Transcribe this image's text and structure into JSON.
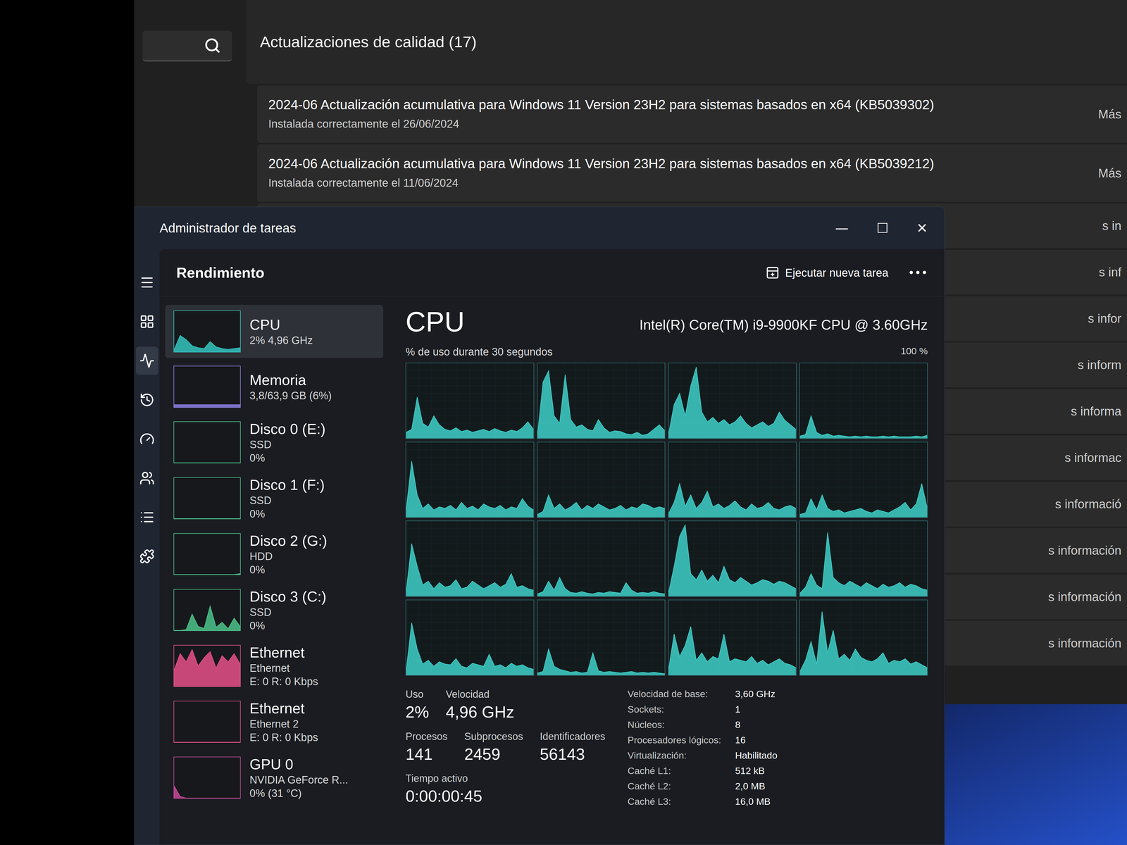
{
  "update_window": {
    "section_title": "Actualizaciones de calidad (17)",
    "updates": [
      {
        "title": "2024-06 Actualización acumulativa para Windows 11 Version 23H2 para sistemas basados en x64 (KB5039302)",
        "status": "Instalada correctamente el 26/06/2024",
        "link": "Más"
      },
      {
        "title": "2024-06 Actualización acumulativa para Windows 11 Version 23H2 para sistemas basados en x64 (KB5039212)",
        "status": "Instalada correctamente el 11/06/2024",
        "link": "Más"
      }
    ],
    "hidden_links": [
      "s in",
      "s inf",
      "s infor",
      "s inform",
      "s informa",
      "s informac",
      "s informació",
      "s información",
      "s información",
      "s información"
    ]
  },
  "task_manager": {
    "title": "Administrador de tareas",
    "controls": [
      "—",
      "☐",
      "✕"
    ],
    "nav": [
      {
        "kind": "menu",
        "selected": false
      },
      {
        "kind": "processes",
        "selected": false
      },
      {
        "kind": "performance",
        "selected": true
      },
      {
        "kind": "history",
        "selected": false
      },
      {
        "kind": "startup",
        "selected": false
      },
      {
        "kind": "users",
        "selected": false
      },
      {
        "kind": "details",
        "selected": false
      },
      {
        "kind": "services",
        "selected": false
      }
    ],
    "page_title": "Rendimiento",
    "run_task": "Ejecutar nueva tarea",
    "more": "•••",
    "resources": [
      {
        "name": "CPU",
        "lines": [
          "2% 4,96 GHz"
        ],
        "selected": true,
        "color": "#35c4bf",
        "values": [
          5,
          40,
          30,
          15,
          10,
          8,
          25,
          12,
          8,
          6,
          8,
          10
        ]
      },
      {
        "name": "Memoria",
        "lines": [
          "3,8/63,9 GB (6%)"
        ],
        "selected": false,
        "color": "#8b7fe0",
        "values": [
          6,
          6,
          6,
          6,
          6,
          6,
          6,
          6,
          6,
          6,
          6,
          6
        ]
      },
      {
        "name": "Disco 0 (E:)",
        "lines": [
          "SSD",
          "0%"
        ],
        "selected": false,
        "color": "#4cc38a",
        "values": [
          0,
          0,
          0,
          0,
          0,
          0,
          0,
          0,
          0,
          0,
          0,
          0
        ]
      },
      {
        "name": "Disco 1 (F:)",
        "lines": [
          "SSD",
          "0%"
        ],
        "selected": false,
        "color": "#4cc38a",
        "values": [
          0,
          0,
          0,
          0,
          0,
          0,
          0,
          0,
          0,
          0,
          0,
          0
        ]
      },
      {
        "name": "Disco 2 (G:)",
        "lines": [
          "HDD",
          "0%"
        ],
        "selected": false,
        "color": "#4cc38a",
        "values": [
          0,
          0,
          0,
          0,
          0,
          0,
          0,
          0,
          0,
          0,
          0,
          2
        ]
      },
      {
        "name": "Disco 3 (C:)",
        "lines": [
          "SSD",
          "0%"
        ],
        "selected": false,
        "color": "#4cc38a",
        "values": [
          0,
          0,
          2,
          40,
          10,
          5,
          60,
          8,
          20,
          4,
          30,
          10
        ]
      },
      {
        "name": "Ethernet",
        "lines": [
          "Ethernet",
          "E: 0 R: 0 Kbps"
        ],
        "selected": false,
        "color": "#e6508a",
        "values": [
          40,
          80,
          60,
          90,
          50,
          70,
          85,
          45,
          75,
          60,
          80,
          55
        ]
      },
      {
        "name": "Ethernet",
        "lines": [
          "Ethernet 2",
          "E: 0 R: 0 Kbps"
        ],
        "selected": false,
        "color": "#e6508a",
        "values": [
          0,
          0,
          0,
          0,
          0,
          0,
          0,
          0,
          0,
          0,
          0,
          0
        ]
      },
      {
        "name": "GPU 0",
        "lines": [
          "NVIDIA GeForce R...",
          "0% (31 °C)"
        ],
        "selected": false,
        "color": "#c84a9a",
        "values": [
          30,
          4,
          0,
          0,
          0,
          0,
          0,
          0,
          0,
          0,
          0,
          0
        ]
      }
    ],
    "cpu": {
      "title": "CPU",
      "model": "Intel(R) Core(TM) i9-9900KF CPU @ 3.60GHz",
      "chart_label": "% de uso durante 30 segundos",
      "max_label": "100 %",
      "cores": [
        [
          8,
          12,
          55,
          20,
          15,
          30,
          18,
          12,
          10,
          14,
          9,
          11,
          8,
          10,
          12,
          9,
          13,
          10,
          8,
          11,
          9,
          14,
          22,
          12
        ],
        [
          5,
          75,
          90,
          30,
          20,
          85,
          25,
          15,
          18,
          12,
          10,
          25,
          14,
          8,
          10,
          9,
          6,
          5,
          8,
          4,
          6,
          12,
          18,
          10
        ],
        [
          6,
          45,
          60,
          30,
          70,
          95,
          35,
          22,
          28,
          20,
          25,
          18,
          22,
          30,
          20,
          14,
          18,
          22,
          16,
          20,
          35,
          24,
          18,
          12
        ],
        [
          3,
          5,
          30,
          8,
          4,
          6,
          3,
          4,
          3,
          2,
          3,
          2,
          3,
          2,
          2,
          3,
          2,
          3,
          2,
          2,
          2,
          3,
          2,
          4
        ],
        [
          10,
          75,
          30,
          12,
          18,
          10,
          14,
          12,
          16,
          10,
          20,
          12,
          15,
          10,
          18,
          14,
          12,
          16,
          10,
          14,
          12,
          25,
          15,
          10
        ],
        [
          4,
          8,
          30,
          12,
          18,
          10,
          14,
          20,
          10,
          16,
          12,
          18,
          14,
          10,
          12,
          16,
          10,
          14,
          12,
          18,
          16,
          12,
          14,
          12
        ],
        [
          5,
          20,
          45,
          15,
          30,
          12,
          20,
          35,
          14,
          18,
          12,
          16,
          22,
          14,
          10,
          18,
          12,
          14,
          20,
          12,
          10,
          14,
          16,
          12
        ],
        [
          4,
          6,
          25,
          10,
          30,
          12,
          8,
          10,
          6,
          8,
          10,
          12,
          8,
          6,
          10,
          8,
          6,
          10,
          14,
          20,
          10,
          18,
          45,
          12
        ],
        [
          6,
          70,
          40,
          15,
          20,
          10,
          18,
          12,
          14,
          22,
          10,
          12,
          20,
          15,
          10,
          14,
          18,
          12,
          16,
          30,
          12,
          14,
          10,
          8
        ],
        [
          3,
          6,
          20,
          8,
          25,
          10,
          5,
          4,
          6,
          4,
          3,
          5,
          4,
          6,
          5,
          4,
          18,
          8,
          4,
          5,
          4,
          6,
          4,
          3
        ],
        [
          5,
          40,
          80,
          95,
          30,
          22,
          35,
          20,
          28,
          18,
          40,
          22,
          18,
          25,
          20,
          15,
          18,
          22,
          20,
          16,
          20,
          18,
          14,
          10
        ],
        [
          4,
          12,
          30,
          15,
          10,
          85,
          25,
          18,
          14,
          20,
          16,
          12,
          18,
          14,
          10,
          16,
          12,
          14,
          18,
          12,
          16,
          14,
          10,
          8
        ],
        [
          6,
          70,
          35,
          15,
          20,
          12,
          18,
          15,
          14,
          22,
          12,
          10,
          16,
          14,
          12,
          28,
          12,
          14,
          10,
          16,
          12,
          14,
          10,
          8
        ],
        [
          3,
          5,
          35,
          12,
          8,
          6,
          4,
          5,
          3,
          4,
          30,
          6,
          4,
          5,
          4,
          3,
          4,
          5,
          3,
          4,
          3,
          4,
          3,
          2
        ],
        [
          8,
          55,
          25,
          40,
          65,
          20,
          30,
          18,
          25,
          22,
          55,
          18,
          22,
          20,
          18,
          25,
          16,
          20,
          14,
          18,
          22,
          16,
          14,
          10
        ],
        [
          5,
          20,
          45,
          15,
          85,
          30,
          60,
          22,
          28,
          20,
          35,
          24,
          20,
          18,
          22,
          30,
          16,
          20,
          18,
          22,
          15,
          18,
          14,
          10
        ]
      ],
      "stat_rows": [
        [
          {
            "label": "Uso",
            "value": "2%"
          },
          {
            "label": "Velocidad",
            "value": "4,96 GHz"
          }
        ],
        [
          {
            "label": "Procesos",
            "value": "141"
          },
          {
            "label": "Subprocesos",
            "value": "2459"
          },
          {
            "label": "Identificadores",
            "value": "56143"
          }
        ],
        [
          {
            "label": "Tiempo activo",
            "value": "0:00:00:45"
          }
        ]
      ],
      "details": [
        {
          "label": "Velocidad de base:",
          "value": "3,60 GHz"
        },
        {
          "label": "Sockets:",
          "value": "1"
        },
        {
          "label": "Núcleos:",
          "value": "8"
        },
        {
          "label": "Procesadores lógicos:",
          "value": "16"
        },
        {
          "label": "Virtualización:",
          "value": "Habilitado"
        },
        {
          "label": "Caché L1:",
          "value": "512 kB"
        },
        {
          "label": "Caché L2:",
          "value": "2,0 MB"
        },
        {
          "label": "Caché L3:",
          "value": "16,0 MB"
        }
      ]
    }
  }
}
